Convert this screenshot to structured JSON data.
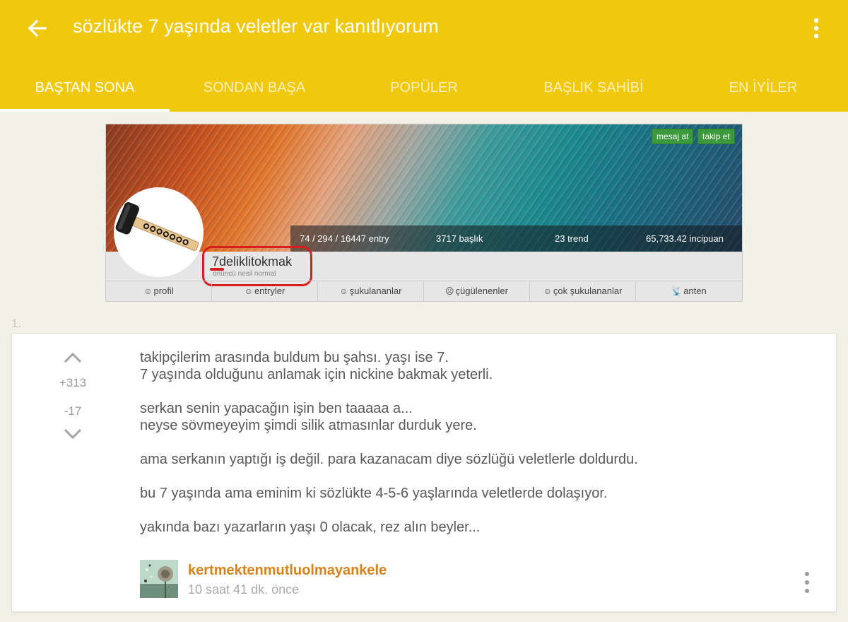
{
  "appbar": {
    "title": "sözlükte 7 yaşında veletler var kanıtlıyorum",
    "background": "#f0c90e",
    "back_icon": "arrow-left-icon",
    "menu_icon": "more-vertical-icon"
  },
  "tabs": [
    {
      "label": "BAŞTAN SONA",
      "active": true
    },
    {
      "label": "SONDAN BAŞA",
      "active": false
    },
    {
      "label": "POPÜLER",
      "active": false
    },
    {
      "label": "BAŞLIK SAHİBİ",
      "active": false
    },
    {
      "label": "EN İYİLER",
      "active": false
    }
  ],
  "profile_image": {
    "buttons": [
      "mesaj at",
      "takip et"
    ],
    "stats": [
      "74 / 294 / 16447 entry",
      "3717 başlık",
      "23 trend",
      "65,733.42 incipuan"
    ],
    "username": "7deliklitokmak",
    "rank": "onüncü nesil normal",
    "nav": [
      {
        "icon": "☺",
        "label": "profil"
      },
      {
        "icon": "☺",
        "label": "entryler"
      },
      {
        "icon": "☺",
        "label": "şukulananlar"
      },
      {
        "icon": "☹",
        "label": "çügülenenler"
      },
      {
        "icon": "☺",
        "label": "çok şukulananlar"
      },
      {
        "icon": "📡",
        "label": "anten"
      }
    ],
    "highlight_color": "#d81e1e"
  },
  "entry": {
    "index": "1.",
    "votes_up": "+313",
    "votes_down": "-17",
    "paragraphs": [
      [
        "takipçilerim arasında buldum bu şahsı. yaşı ise 7.",
        "7 yaşında olduğunu anlamak için nickine bakmak yeterli."
      ],
      [
        "serkan senin yapacağın işin ben taaaaa a...",
        "neyse sövmeyeyim şimdi silik atmasınlar durduk yere."
      ],
      [
        "ama serkanın yaptığı iş değil. para kazanacam diye sözlüğü veletlerle doldurdu."
      ],
      [
        "bu 7 yaşında ama eminim ki sözlükte 4-5-6 yaşlarında veletlerde dolaşıyor."
      ],
      [
        "yakında bazı yazarların yaşı 0 olacak, rez alın beyler..."
      ]
    ],
    "author": "kertmektenmutluolmayankele",
    "time": "10 saat 41 dk. önce",
    "author_color": "#d7831c"
  }
}
